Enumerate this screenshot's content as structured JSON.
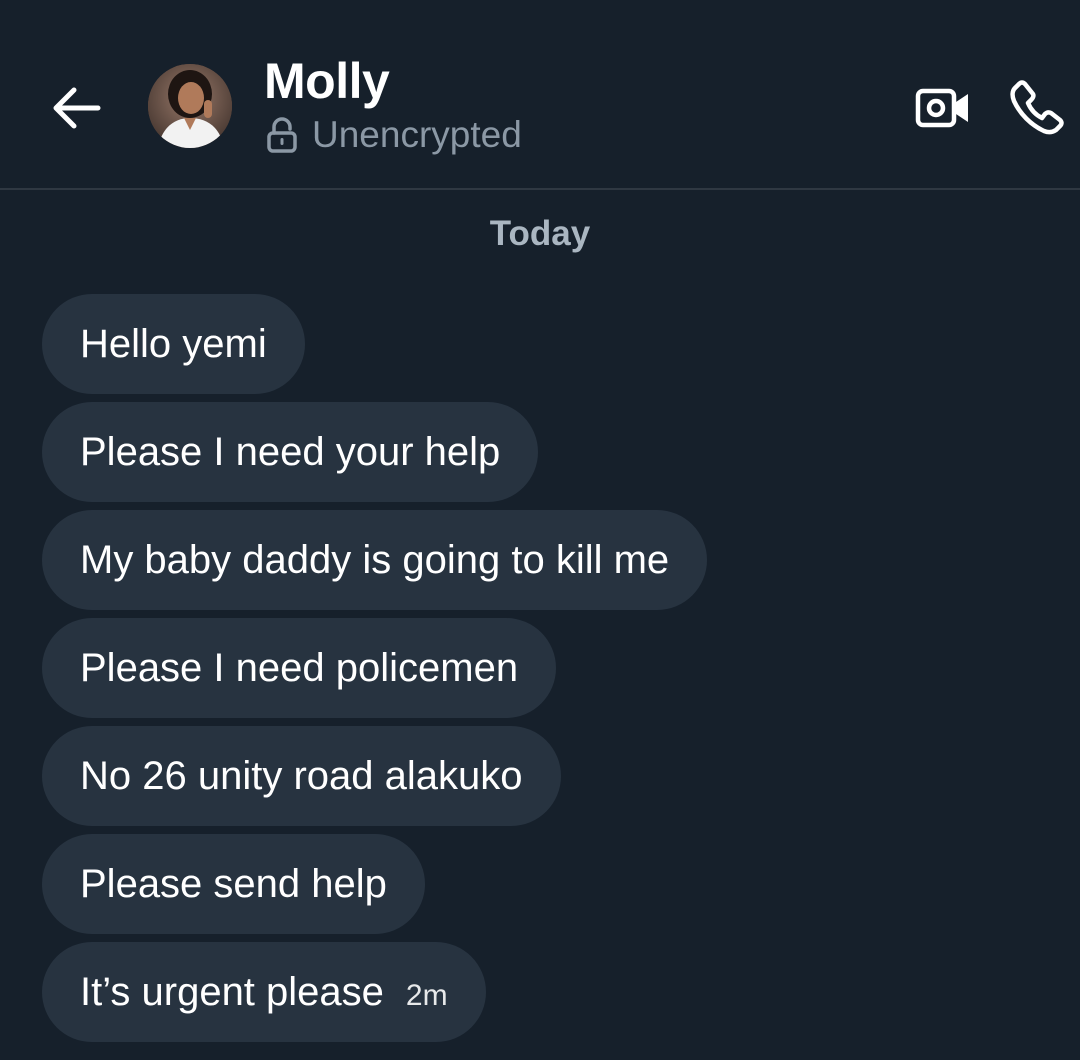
{
  "header": {
    "contact_name": "Molly",
    "status_text": "Unencrypted",
    "icons": {
      "back": "arrow-left-icon",
      "lock": "lock-open-icon",
      "video": "video-camera-icon",
      "call": "phone-icon"
    }
  },
  "conversation": {
    "date_separator": "Today",
    "messages": [
      {
        "text": "Hello yemi"
      },
      {
        "text": "Please I need your help"
      },
      {
        "text": "My baby daddy is going to kill me"
      },
      {
        "text": "Please I need policemen"
      },
      {
        "text": "No 26 unity road alakuko"
      },
      {
        "text": "Please send help"
      },
      {
        "text": "It’s urgent please",
        "time": "2m"
      }
    ]
  },
  "colors": {
    "background": "#16202b",
    "bubble": "#273340",
    "muted_text": "#8b98a5"
  }
}
